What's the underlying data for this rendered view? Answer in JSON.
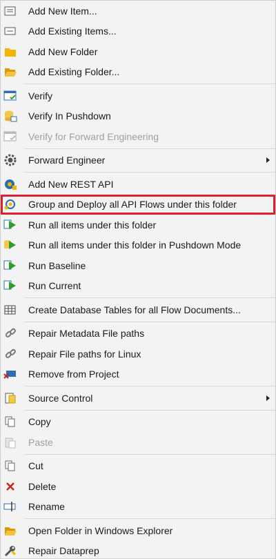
{
  "menu": {
    "items": [
      {
        "label": "Add New Item...",
        "icon": "add-new-item-icon"
      },
      {
        "label": "Add Existing Items...",
        "icon": "add-existing-items-icon"
      },
      {
        "label": "Add New Folder",
        "icon": "new-folder-icon"
      },
      {
        "label": "Add Existing Folder...",
        "icon": "open-folder-icon"
      },
      {
        "label": "Verify",
        "icon": "verify-icon"
      },
      {
        "label": "Verify In Pushdown",
        "icon": "verify-pushdown-icon"
      },
      {
        "label": "Verify for Forward Engineering",
        "icon": "verify-forward-icon",
        "disabled": true
      },
      {
        "label": "Forward Engineer",
        "icon": "gear-icon",
        "submenu": true
      },
      {
        "label": "Add New REST API",
        "icon": "rest-api-icon"
      },
      {
        "label": "Group and Deploy all API Flows under this folder",
        "icon": "deploy-flows-icon",
        "highlighted": true
      },
      {
        "label": "Run all items under this folder",
        "icon": "run-all-icon"
      },
      {
        "label": "Run all items under this folder in Pushdown Mode",
        "icon": "run-pushdown-icon"
      },
      {
        "label": "Run Baseline",
        "icon": "run-baseline-icon"
      },
      {
        "label": "Run Current",
        "icon": "run-current-icon"
      },
      {
        "label": "Create Database Tables for all Flow Documents...",
        "icon": "table-icon"
      },
      {
        "label": "Repair Metadata File paths",
        "icon": "link-icon"
      },
      {
        "label": "Repair File paths for Linux",
        "icon": "link-icon"
      },
      {
        "label": "Remove from Project",
        "icon": "remove-icon"
      },
      {
        "label": "Source Control",
        "icon": "source-control-icon",
        "submenu": true
      },
      {
        "label": "Copy",
        "icon": "copy-icon"
      },
      {
        "label": "Paste",
        "icon": "paste-icon",
        "disabled": true
      },
      {
        "label": "Cut",
        "icon": "cut-icon"
      },
      {
        "label": "Delete",
        "icon": "delete-icon"
      },
      {
        "label": "Rename",
        "icon": "rename-icon"
      },
      {
        "label": "Open Folder in Windows Explorer",
        "icon": "explorer-folder-icon"
      },
      {
        "label": "Repair Dataprep",
        "icon": "wrench-icon"
      }
    ]
  },
  "colors": {
    "highlight_border": "#e0202e",
    "folder": "#f2b400",
    "run_green": "#2aa02a",
    "delete_red": "#d01f1f"
  }
}
